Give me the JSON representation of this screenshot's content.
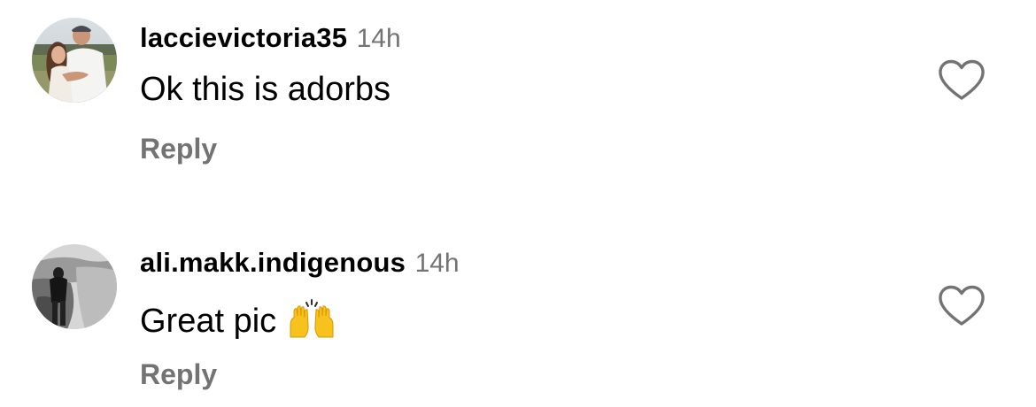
{
  "comments": [
    {
      "username": "laccievictoria35",
      "timestamp": "14h",
      "text": "Ok this is adorbs",
      "emoji": "",
      "reply_label": "Reply",
      "like_icon": "heart-outline-icon",
      "avatar": "profile-photo-couple"
    },
    {
      "username": "ali.makk.indigenous",
      "timestamp": "14h",
      "text": "Great pic",
      "emoji": "raising-hands-emoji",
      "reply_label": "Reply",
      "like_icon": "heart-outline-icon",
      "avatar": "profile-photo-landscape-bw"
    }
  ],
  "colors": {
    "text": "#000000",
    "secondary": "#737373",
    "background": "#ffffff"
  }
}
